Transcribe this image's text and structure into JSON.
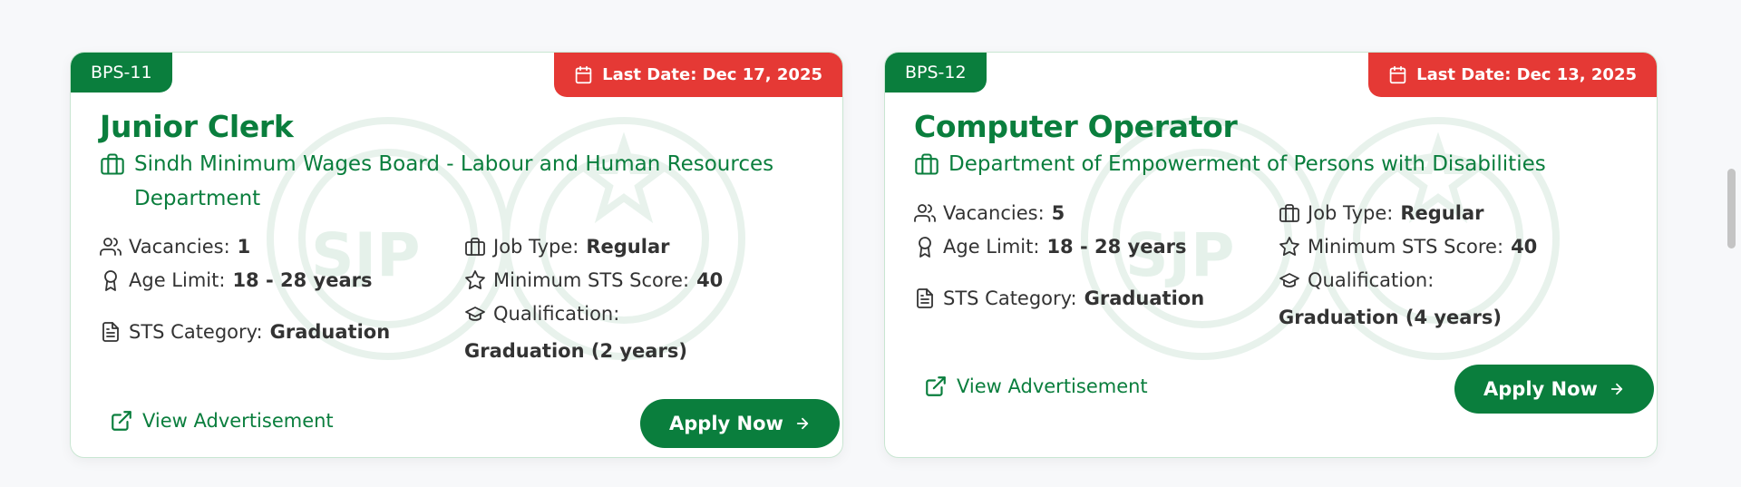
{
  "jobs": [
    {
      "bps": "BPS-11",
      "last_date": "Last Date: Dec 17, 2025",
      "title": "Junior Clerk",
      "department": "Sindh Minimum Wages Board - Labour and Human Resources Department",
      "vacancies_label": "Vacancies:",
      "vacancies": "1",
      "age_label": "Age Limit:",
      "age": "18 - 28 years",
      "sts_category_label": "STS Category:",
      "sts_category": "Graduation",
      "job_type_label": "Job Type:",
      "job_type": "Regular",
      "min_sts_label": "Minimum STS Score:",
      "min_sts": "40",
      "qualification_label": "Qualification:",
      "qualification": "Graduation (2 years)",
      "view_ad": "View Advertisement",
      "apply": "Apply Now"
    },
    {
      "bps": "BPS-12",
      "last_date": "Last Date: Dec 13, 2025",
      "title": "Computer Operator",
      "department": "Department of Empowerment of Persons with Disabilities",
      "vacancies_label": "Vacancies:",
      "vacancies": "5",
      "age_label": "Age Limit:",
      "age": "18 - 28 years",
      "sts_category_label": "STS Category:",
      "sts_category": "Graduation",
      "job_type_label": "Job Type:",
      "job_type": "Regular",
      "min_sts_label": "Minimum STS Score:",
      "min_sts": "40",
      "qualification_label": "Qualification:",
      "qualification": "Graduation (4 years)",
      "view_ad": "View Advertisement",
      "apply": "Apply Now"
    }
  ],
  "watermark": "SJP",
  "colors": {
    "brand_green": "#0a7e3d",
    "deadline_red": "#e53935",
    "card_border": "#c9e6d2"
  },
  "icons": {
    "deadline": "calendar-icon",
    "department": "briefcase-icon",
    "vacancies": "users-icon",
    "age": "award-icon",
    "sts_category": "file-text-icon",
    "job_type": "briefcase-icon",
    "min_sts": "star-icon",
    "qualification": "graduation-cap-icon",
    "view_ad": "external-link-icon",
    "apply": "arrow-right-icon"
  }
}
